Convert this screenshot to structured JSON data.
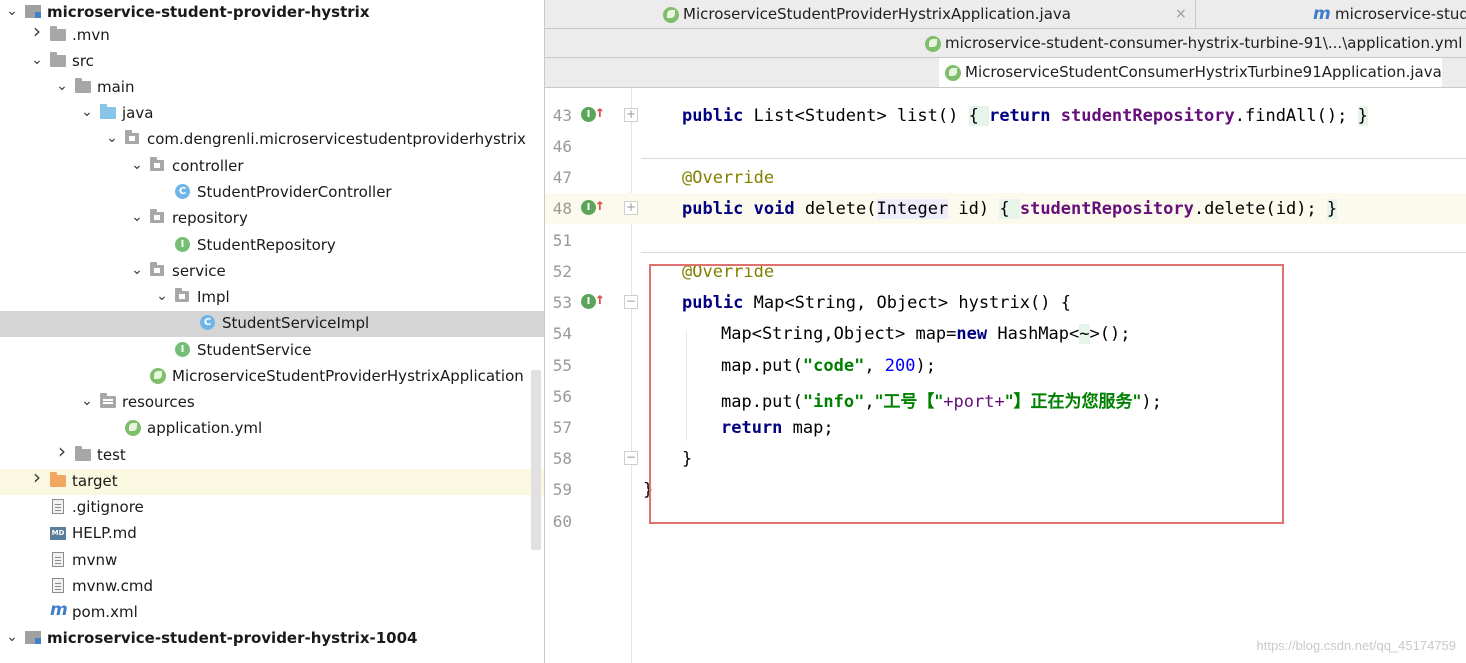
{
  "project_tree": {
    "items": [
      {
        "label": "microservice-student-provider-hystrix",
        "icon": "module-icon",
        "arrow": "open"
      },
      {
        "label": ".mvn",
        "icon": "folder-icon",
        "arrow": "closed"
      },
      {
        "label": "src",
        "icon": "folder-icon",
        "arrow": "open"
      },
      {
        "label": "main",
        "icon": "folder-icon",
        "arrow": "open"
      },
      {
        "label": "java",
        "icon": "source-folder-icon",
        "arrow": "open"
      },
      {
        "label": "com.dengrenli.microservicestudentproviderhystrix",
        "icon": "package-icon",
        "arrow": "open"
      },
      {
        "label": "controller",
        "icon": "package-icon",
        "arrow": "open"
      },
      {
        "label": "StudentProviderController",
        "icon": "class-icon"
      },
      {
        "label": "repository",
        "icon": "package-icon",
        "arrow": "open"
      },
      {
        "label": "StudentRepository",
        "icon": "interface-icon"
      },
      {
        "label": "service",
        "icon": "package-icon",
        "arrow": "open"
      },
      {
        "label": "Impl",
        "icon": "package-icon",
        "arrow": "open"
      },
      {
        "label": "StudentServiceImpl",
        "icon": "class-icon",
        "selected": true
      },
      {
        "label": "StudentService",
        "icon": "interface-icon"
      },
      {
        "label": "MicroserviceStudentProviderHystrixApplication",
        "icon": "spring-class-icon"
      },
      {
        "label": "resources",
        "icon": "resources-folder-icon",
        "arrow": "open"
      },
      {
        "label": "application.yml",
        "icon": "spring-yml-icon"
      },
      {
        "label": "test",
        "icon": "folder-icon",
        "arrow": "closed"
      },
      {
        "label": "target",
        "icon": "excluded-folder-icon",
        "arrow": "closed"
      },
      {
        "label": ".gitignore",
        "icon": "text-file-icon"
      },
      {
        "label": "HELP.md",
        "icon": "markdown-file-icon",
        "badge": "MD"
      },
      {
        "label": "mvnw",
        "icon": "text-file-icon"
      },
      {
        "label": "mvnw.cmd",
        "icon": "text-file-icon"
      },
      {
        "label": "pom.xml",
        "icon": "maven-icon",
        "glyph": "m"
      },
      {
        "label": "microservice-student-provider-hystrix-1004",
        "icon": "module-icon",
        "arrow": "open"
      }
    ]
  },
  "tabs": {
    "row1": [
      {
        "label": "MicroserviceStudentProviderHystrixApplication.java",
        "icon": "spring-class-icon",
        "close": "×"
      },
      {
        "label": "microservice-stud",
        "icon": "maven-icon",
        "glyph": "m"
      }
    ],
    "row2": [
      {
        "label": "microservice-student-consumer-hystrix-turbine-91\\...\\application.yml",
        "icon": "spring-yml-icon"
      }
    ],
    "row3": [
      {
        "label": "MicroserviceStudentConsumerHystrixTurbine91Application.java",
        "icon": "spring-class-icon"
      }
    ]
  },
  "editor": {
    "lines": {
      "l43": {
        "num": "43",
        "t1": "public",
        "t2": " List<Student> list() ",
        "t3": "{ ",
        "t4": "return",
        "t5": " ",
        "t6": "studentRepository",
        "t7": ".findAll(); ",
        "t8": "}"
      },
      "l46": {
        "num": "46"
      },
      "l47": {
        "num": "47",
        "t1": "@Override"
      },
      "l48": {
        "num": "48",
        "t1": "public",
        "t2": " ",
        "t3": "void",
        "t4": " delete(",
        "t5": "Integer",
        "t6": " id) ",
        "t7": "{ ",
        "t8": "studentRepository",
        "t9": ".delete(id); ",
        "t10": "}"
      },
      "l51": {
        "num": "51"
      },
      "l52": {
        "num": "52",
        "t1": "@Override"
      },
      "l53": {
        "num": "53",
        "t1": "public",
        "t2": " Map<String, Object> hystrix() {"
      },
      "l54": {
        "num": "54",
        "t1": "Map<String,Object> map=",
        "t2": "new",
        "t3": " HashMap<",
        "t4": "~",
        "t5": ">();"
      },
      "l55": {
        "num": "55",
        "t1": "map.put(",
        "t2": "\"code\"",
        "t3": ", ",
        "t4": "200",
        "t5": ");"
      },
      "l56": {
        "num": "56",
        "t1": "map.put(",
        "t2": "\"info\"",
        "t3": ",",
        "t4": "\"工号【\"",
        "t5": "+port+",
        "t6": "\"】正在为您服务\"",
        "t7": ");"
      },
      "l57": {
        "num": "57",
        "t1": "return",
        "t2": " map;"
      },
      "l58": {
        "num": "58",
        "t1": "}"
      },
      "l59": {
        "num": "59",
        "t1": "}"
      },
      "l60": {
        "num": "60"
      }
    },
    "gutter_marker": "I",
    "override_arrow": "↑",
    "fold_collapsed": "+",
    "fold_open": "−"
  },
  "watermark": "https://blog.csdn.net/qq_45174759"
}
